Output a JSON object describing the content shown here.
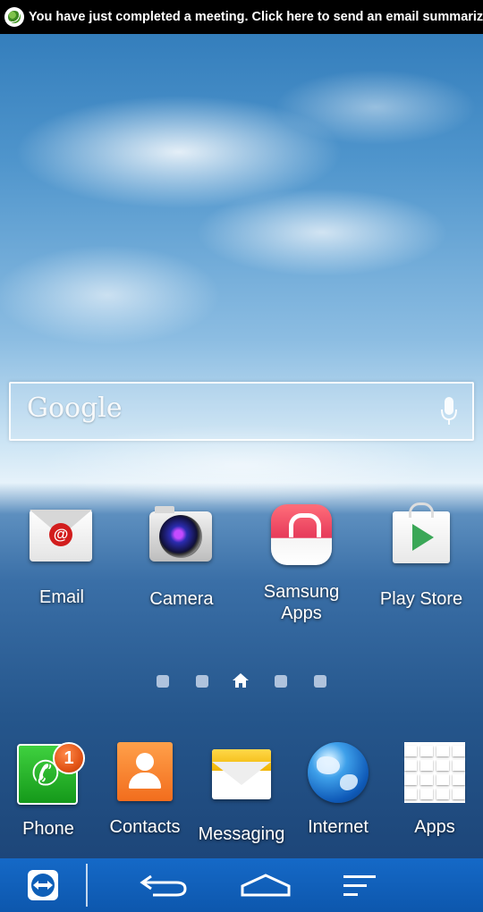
{
  "statusbar": {
    "notification_icon": "teamviewer-meeting-icon",
    "notification_text": "You have just completed a meeting. Click here to send an email summarizing it.."
  },
  "search": {
    "logo_text": "Google",
    "mic_icon": "microphone-icon"
  },
  "home_apps": [
    {
      "label": "Email",
      "icon": "email-icon"
    },
    {
      "label": "Camera",
      "icon": "camera-icon"
    },
    {
      "label": "Samsung Apps",
      "icon": "samsung-apps-icon"
    },
    {
      "label": "Play Store",
      "icon": "play-store-icon"
    }
  ],
  "page_indicator": {
    "pages": 5,
    "current": 3
  },
  "dock": [
    {
      "label": "Phone",
      "icon": "phone-icon",
      "badge": "1"
    },
    {
      "label": "Contacts",
      "icon": "contacts-icon"
    },
    {
      "label": "Messaging",
      "icon": "messaging-icon"
    },
    {
      "label": "Internet",
      "icon": "internet-icon"
    },
    {
      "label": "Apps",
      "icon": "apps-grid-icon"
    }
  ],
  "navbar": {
    "buttons": [
      "teamviewer-icon",
      "back-icon",
      "home-icon",
      "menu-icon"
    ]
  },
  "colors": {
    "status_bar": "#000000",
    "nav_bar": "#1262c0",
    "badge": "#e25416"
  }
}
